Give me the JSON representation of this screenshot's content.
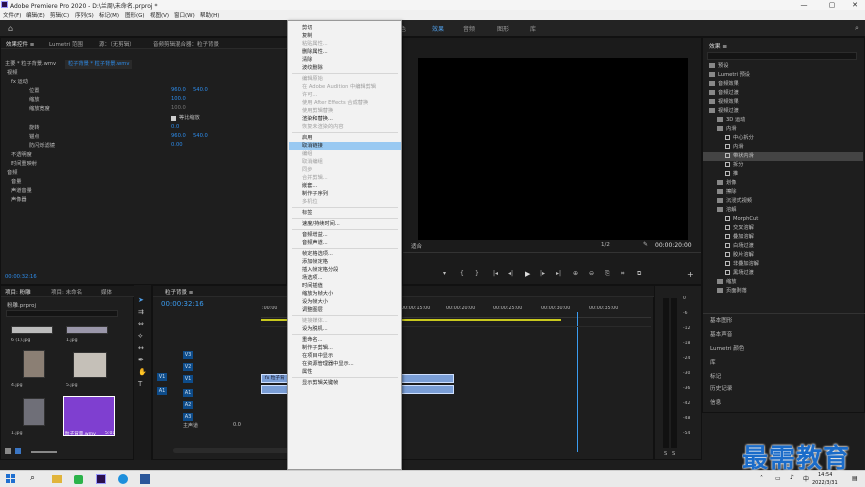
{
  "window": {
    "title": "Adobe Premiere Pro 2020 - D:\\兰周\\未命名.prproj *",
    "controls": [
      "—",
      "▢",
      "✕"
    ]
  },
  "menu": [
    "文件(F)",
    "编辑(E)",
    "剪辑(C)",
    "序列(S)",
    "标记(M)",
    "图形(G)",
    "视图(V)",
    "窗口(W)",
    "帮助(H)"
  ],
  "workspaces": {
    "items": [
      "色",
      "效果",
      "音频",
      "图形",
      "库"
    ],
    "active": "效果"
  },
  "effect_controls": {
    "tabs": [
      "效果控件 ≡",
      "Lumetri 范围",
      "源：（无剪辑）",
      "音频剪辑混合器：粒子背景"
    ],
    "clip_path": "主要 * 粒子背景.wmv",
    "clip_tab": "粒子背景 * 粒子背景.wmv",
    "section_video": "视频",
    "motion": "fx 运动",
    "position_label": "位置",
    "position_x": "960.0",
    "position_y": "540.0",
    "scale_label": "缩放",
    "scale_value": "100.0",
    "scale_width_label": "缩放宽度",
    "scale_width_value": "100.0",
    "uniform_label": "等比缩放",
    "rotation_label": "旋转",
    "rotation_value": "0.0",
    "anchor_label": "锚点",
    "anchor_x": "960.0",
    "anchor_y": "540.0",
    "flicker_label": "防闪烁滤镜",
    "flicker_value": "0.00",
    "opacity": "不透明度",
    "time_remap": "时间重映射",
    "section_audio": "音频",
    "volume": "音量",
    "channel_volume": "声道音量",
    "panner": "声像器",
    "timecode": "00:00:32:16"
  },
  "context_menu": {
    "items": [
      {
        "label": "剪切",
        "enabled": true
      },
      {
        "label": "复制",
        "enabled": true
      },
      {
        "label": "粘贴属性...",
        "enabled": false
      },
      {
        "label": "删除属性...",
        "enabled": true
      },
      {
        "label": "清除",
        "enabled": true
      },
      {
        "label": "波纹删除",
        "enabled": true
      },
      {
        "sep": true
      },
      {
        "label": "编辑原始",
        "enabled": false
      },
      {
        "label": "在 Adobe Audition 中编辑剪辑",
        "enabled": false
      },
      {
        "label": "许可...",
        "enabled": false
      },
      {
        "label": "使用 After Effects 合成替换",
        "enabled": false
      },
      {
        "label": "使用剪辑替换",
        "enabled": false,
        "submenu": true
      },
      {
        "label": "渲染和替换...",
        "enabled": true
      },
      {
        "label": "恢复未渲染的内容",
        "enabled": false
      },
      {
        "sep": true
      },
      {
        "label": "启用",
        "enabled": true,
        "checked": true
      },
      {
        "label": "取消链接",
        "enabled": true,
        "highlight": true
      },
      {
        "label": "编组",
        "enabled": false
      },
      {
        "label": "取消编组",
        "enabled": false
      },
      {
        "label": "同步",
        "enabled": false
      },
      {
        "label": "合并剪辑...",
        "enabled": false
      },
      {
        "label": "嵌套...",
        "enabled": true
      },
      {
        "label": "制作子序列",
        "enabled": true
      },
      {
        "label": "多机位",
        "enabled": false,
        "submenu": true
      },
      {
        "sep": true
      },
      {
        "label": "标签",
        "enabled": true,
        "submenu": true
      },
      {
        "sep": true
      },
      {
        "label": "速度/持续时间...",
        "enabled": true
      },
      {
        "sep": true
      },
      {
        "label": "音频增益...",
        "enabled": true
      },
      {
        "label": "音频声道...",
        "enabled": true
      },
      {
        "sep": true
      },
      {
        "label": "帧定格选项...",
        "enabled": true
      },
      {
        "label": "添加帧定格",
        "enabled": true
      },
      {
        "label": "插入帧定格分段",
        "enabled": true
      },
      {
        "label": "场选项...",
        "enabled": true
      },
      {
        "label": "时间插值",
        "enabled": true,
        "submenu": true
      },
      {
        "label": "缩放为帧大小",
        "enabled": true
      },
      {
        "label": "设为帧大小",
        "enabled": true
      },
      {
        "label": "调整图层",
        "enabled": true
      },
      {
        "sep": true
      },
      {
        "label": "链接媒体...",
        "enabled": false
      },
      {
        "label": "设为脱机...",
        "enabled": true
      },
      {
        "sep": true
      },
      {
        "label": "重命名...",
        "enabled": true
      },
      {
        "label": "制作子剪辑...",
        "enabled": true
      },
      {
        "label": "在项目中显示",
        "enabled": true
      },
      {
        "label": "在资源管理器中显示...",
        "enabled": true
      },
      {
        "label": "属性",
        "enabled": true
      },
      {
        "sep": true
      },
      {
        "label": "显示剪辑关键帧",
        "enabled": true,
        "submenu": true
      }
    ]
  },
  "program": {
    "fit_label": "适合",
    "resolution": "1/2",
    "timecode": "00:00:20:00",
    "transport": [
      "▾",
      "{",
      "}",
      "|◂",
      "◂|",
      "▶",
      "|▸",
      "▸|",
      "⊕",
      "⊖",
      "⎘",
      "⌗",
      "⧉"
    ]
  },
  "effects_panel": {
    "title": "效果 ≡",
    "tree": [
      {
        "label": "预设",
        "level": 0,
        "folder": true
      },
      {
        "label": "Lumetri 预设",
        "level": 0,
        "folder": true
      },
      {
        "label": "音频效果",
        "level": 0,
        "folder": true
      },
      {
        "label": "音频过渡",
        "level": 0,
        "folder": true
      },
      {
        "label": "视频效果",
        "level": 0,
        "folder": true
      },
      {
        "label": "视频过渡",
        "level": 0,
        "folder": true
      },
      {
        "label": "3D 运动",
        "level": 1,
        "folder": true
      },
      {
        "label": "内滑",
        "level": 1,
        "folder": true
      },
      {
        "label": "中心拆分",
        "level": 2
      },
      {
        "label": "内滑",
        "level": 2
      },
      {
        "label": "带状内滑",
        "level": 2,
        "selected": true
      },
      {
        "label": "拆分",
        "level": 2
      },
      {
        "label": "推",
        "level": 2
      },
      {
        "label": "划像",
        "level": 1,
        "folder": true
      },
      {
        "label": "擦除",
        "level": 1,
        "folder": true
      },
      {
        "label": "沉浸式视频",
        "level": 1,
        "folder": true
      },
      {
        "label": "溶解",
        "level": 1,
        "folder": true
      },
      {
        "label": "MorphCut",
        "level": 2
      },
      {
        "label": "交叉溶解",
        "level": 2
      },
      {
        "label": "叠加溶解",
        "level": 2
      },
      {
        "label": "白场过渡",
        "level": 2
      },
      {
        "label": "胶片溶解",
        "level": 2
      },
      {
        "label": "非叠加溶解",
        "level": 2
      },
      {
        "label": "黑场过渡",
        "level": 2
      },
      {
        "label": "缩放",
        "level": 1,
        "folder": true
      },
      {
        "label": "页面剥落",
        "level": 1,
        "folder": true
      }
    ],
    "panels": [
      "基本图形",
      "基本声音",
      "Lumetri 颜色",
      "库",
      "标记",
      "历史记录",
      "信息"
    ]
  },
  "project": {
    "tabs": [
      "项目: 粉雕",
      "项目: 未命名",
      "媒体"
    ],
    "file": "粉雕.prproj",
    "thumbs": [
      "6 (1).jpg",
      "1.jpg",
      "4.jpg",
      "5.jpg",
      "1.jpg",
      "粒子背景.wmv"
    ],
    "thumb_meta": [
      "",
      "",
      "",
      "",
      "",
      "5:01"
    ]
  },
  "timeline": {
    "tab": "粒子背景 ≡",
    "timecode": "00:00:32:16",
    "ruler": [
      ":00:00",
      "00:00:15:00",
      "00:00:20:00",
      "00:00:25:00",
      "00:00:30:00",
      "00:00:35:00"
    ],
    "tracks_video": [
      "V3",
      "V2",
      "V1"
    ],
    "tracks_audio": [
      "A1",
      "A2",
      "A3"
    ],
    "master": "主声道",
    "master_value": "0.0",
    "source_v": "V1",
    "source_a": "A1",
    "clip_video": "粒子背",
    "clip_video_overlay": "fx"
  },
  "meter": {
    "labels": [
      "0",
      "-6",
      "-12",
      "-18",
      "-24",
      "-30",
      "-36",
      "-42",
      "-48",
      "-54"
    ],
    "footer": [
      "S",
      "S"
    ]
  },
  "taskbar": {
    "time": "14:54",
    "date": "2022/3/31",
    "lang": "中"
  },
  "watermark": "最需教育",
  "colors": {
    "accent": "#2d8ceb",
    "highlight": "#99c9f2",
    "clip": "#7a9ed6"
  }
}
